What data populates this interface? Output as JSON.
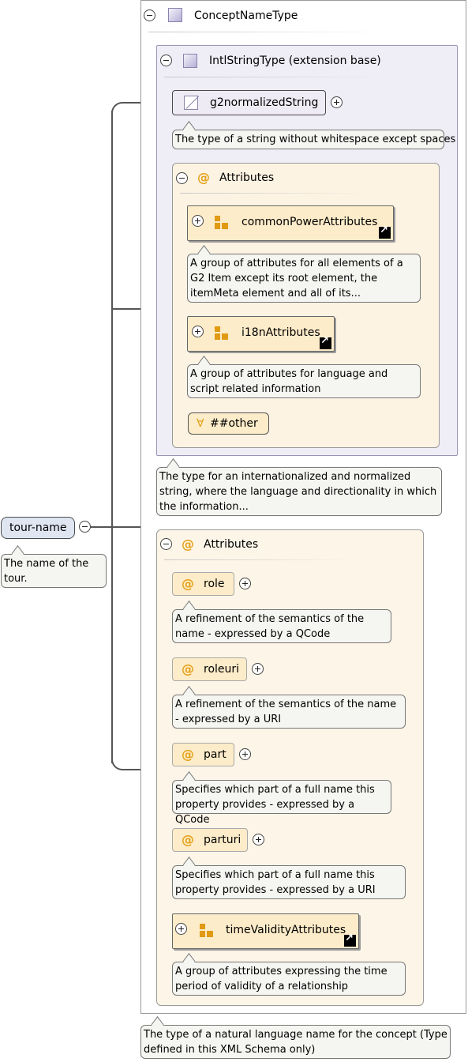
{
  "element": {
    "name": "tour-name",
    "note": "The name of the tour."
  },
  "type": {
    "name": "ConceptNameType",
    "note": "The type of a natural language name for the concept (Type defined in this XML Schema only)"
  },
  "extension": {
    "name": "IntlStringType (extension base)",
    "note": "The type for an internationalized and normalized string, where the language and directionality in which the information...",
    "base": {
      "name": "g2normalizedString",
      "note": "The type of a string without whitespace except spaces"
    },
    "attributes": {
      "label": "Attributes",
      "groups": [
        {
          "name": "commonPowerAttributes",
          "note": "A group of attributes for all elements of a G2 Item except its root element, the itemMeta element and all of its..."
        },
        {
          "name": "i18nAttributes",
          "note": "A group of attributes for language and script related information"
        }
      ],
      "any": "##other"
    }
  },
  "attributes": {
    "label": "Attributes",
    "items": [
      {
        "name": "role",
        "note": "A refinement of the semantics of the name - expressed by a QCode"
      },
      {
        "name": "roleuri",
        "note": "A refinement of the semantics of the name - expressed by a URI"
      },
      {
        "name": "part",
        "note": "Specifies which part of a full name this property provides - expressed by a QCode"
      },
      {
        "name": "parturi",
        "note": "Specifies which part of a full name this property provides - expressed by a URI"
      }
    ],
    "group": {
      "name": "timeValidityAttributes",
      "note": "A group of attributes expressing the time period of validity of a relationship"
    }
  },
  "icons": {
    "collapse": "collapse-icon",
    "expand": "expand-icon",
    "complex_type": "complex-type-icon",
    "simple_type": "simple-type-icon",
    "attribute": "attribute-icon",
    "attribute_group": "attribute-group-icon",
    "reference": "reference-link-icon",
    "any_attribute": "any-attribute-icon"
  },
  "colors": {
    "element_fill": "#dfe6f2",
    "attribute_fill": "#fdecc9",
    "attribute_icon": "#e3a21a",
    "type_fill": "#efedf6"
  }
}
